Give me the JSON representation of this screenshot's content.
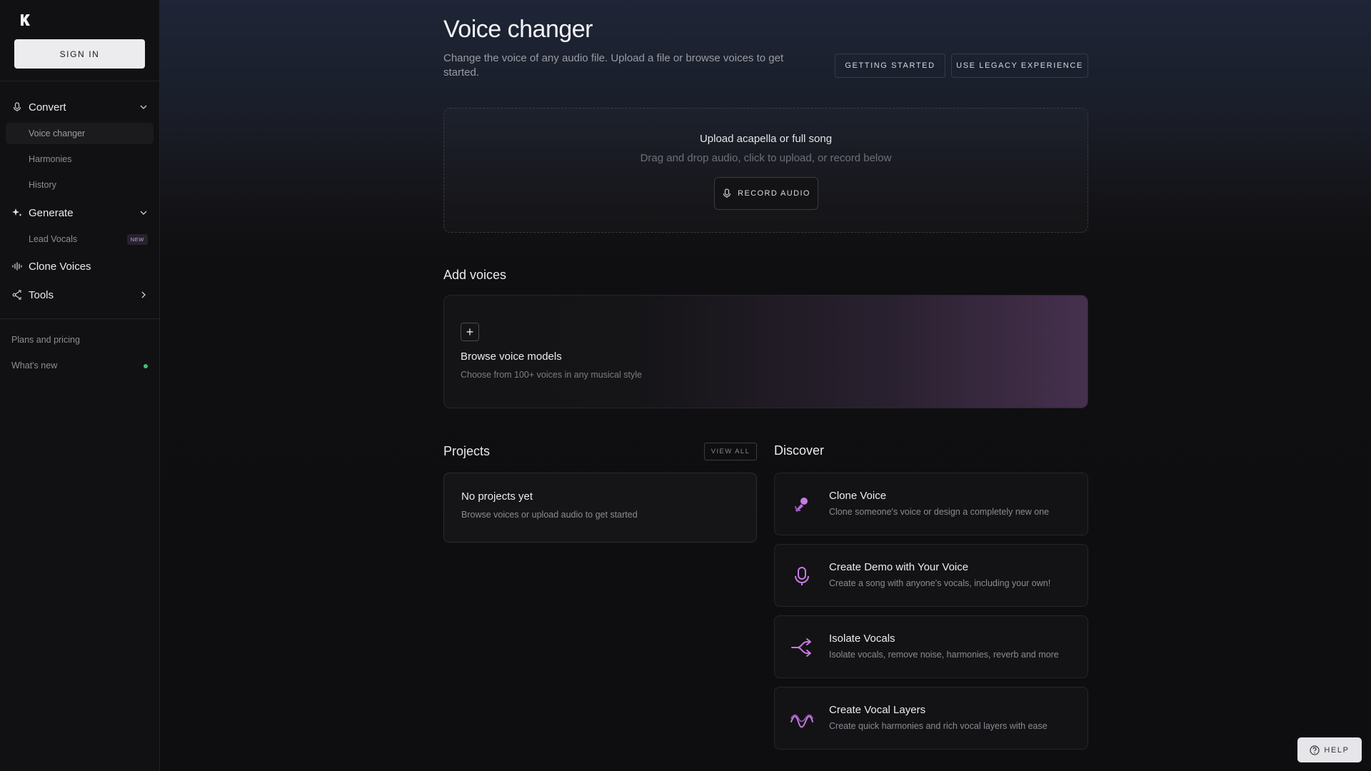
{
  "sidebar": {
    "sign_in": "SIGN IN",
    "sections": {
      "convert": "Convert",
      "generate": "Generate",
      "clone_voices": "Clone Voices",
      "tools": "Tools"
    },
    "convert_items": [
      "Voice changer",
      "Harmonies",
      "History"
    ],
    "generate_items": [
      {
        "label": "Lead Vocals",
        "badge": "NEW"
      }
    ],
    "footer": {
      "plans": "Plans and pricing",
      "whats_new": "What's new"
    }
  },
  "header": {
    "title": "Voice changer",
    "subtitle": "Change the voice of any audio file. Upload a file or browse voices to get started.",
    "getting_started": "GETTING STARTED",
    "legacy": "USE LEGACY EXPERIENCE"
  },
  "upload": {
    "title": "Upload acapella or full song",
    "subtitle": "Drag and drop audio, click to upload, or record below",
    "record": "RECORD AUDIO"
  },
  "add_voices": {
    "title": "Add voices",
    "card_title": "Browse voice models",
    "card_sub": "Choose from 100+ voices in any musical style"
  },
  "projects": {
    "title": "Projects",
    "view_all": "VIEW ALL",
    "empty_title": "No projects yet",
    "empty_sub": "Browse voices or upload audio to get started"
  },
  "discover": {
    "title": "Discover",
    "items": [
      {
        "title": "Clone Voice",
        "sub": "Clone someone's voice or design a completely new one",
        "icon": "microphone-person-icon"
      },
      {
        "title": "Create Demo with Your Voice",
        "sub": "Create a song with anyone's vocals, including your own!",
        "icon": "microphone-icon"
      },
      {
        "title": "Isolate Vocals",
        "sub": "Isolate vocals, remove noise, harmonies, reverb and more",
        "icon": "split-arrows-icon"
      },
      {
        "title": "Create Vocal Layers",
        "sub": "Create quick harmonies and rich vocal layers with ease",
        "icon": "waves-icon"
      }
    ]
  },
  "help": "HELP",
  "colors": {
    "accent": "#c77be0",
    "dot": "#3fbf77"
  }
}
